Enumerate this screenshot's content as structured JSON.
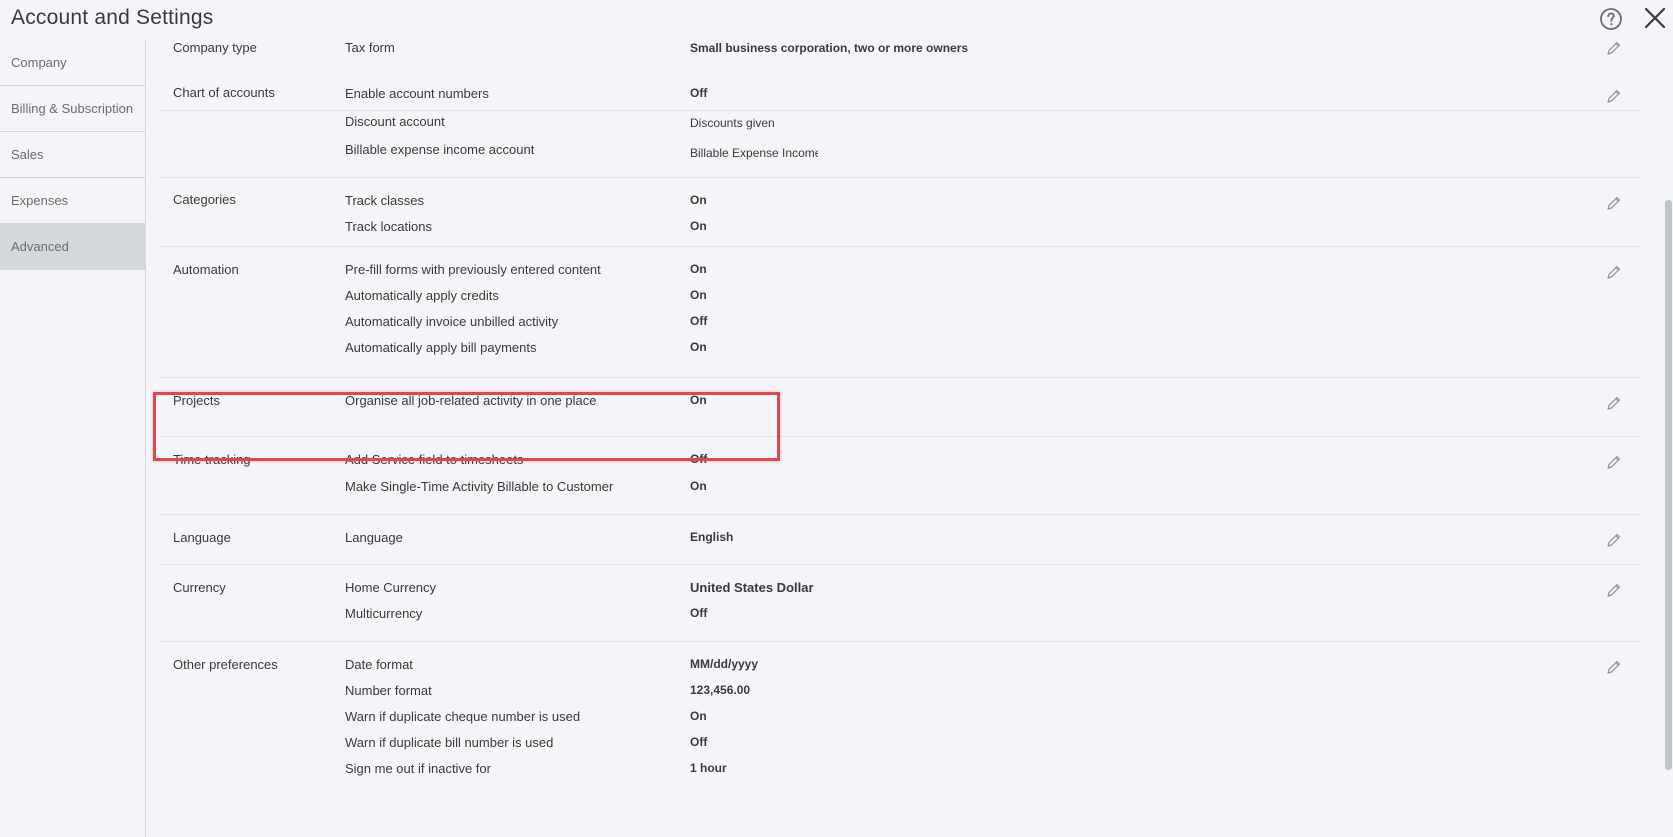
{
  "header": {
    "title": "Account and Settings"
  },
  "icons": {
    "help": "help-circle-icon",
    "close": "close-icon",
    "edit": "pencil-icon"
  },
  "colors": {
    "highlight_border": "#e0474c",
    "background": "#f4f5f8",
    "active_nav": "#d4d7dc"
  },
  "sidebar": {
    "items": [
      {
        "label": "Company"
      },
      {
        "label": "Billing & Subscription"
      },
      {
        "label": "Sales"
      },
      {
        "label": "Expenses"
      },
      {
        "label": "Advanced",
        "active": true
      }
    ]
  },
  "sections": {
    "company_type": {
      "name": "Company type",
      "rows": [
        {
          "label": "Tax form",
          "value": "Small business corporation, two or more owners"
        }
      ]
    },
    "chart_of_accounts": {
      "name": "Chart of accounts",
      "rows": [
        {
          "label": "Enable account numbers",
          "value": "Off"
        },
        {
          "label": "Discount account",
          "value": "Discounts given"
        },
        {
          "label": "Billable expense income account",
          "value": "Billable Expense Income"
        }
      ]
    },
    "categories": {
      "name": "Categories",
      "rows": [
        {
          "label": "Track classes",
          "value": "On"
        },
        {
          "label": "Track locations",
          "value": "On"
        }
      ]
    },
    "automation": {
      "name": "Automation",
      "rows": [
        {
          "label": "Pre-fill forms with previously entered content",
          "value": "On"
        },
        {
          "label": "Automatically apply credits",
          "value": "On"
        },
        {
          "label": "Automatically invoice unbilled activity",
          "value": "Off"
        },
        {
          "label": "Automatically apply bill payments",
          "value": "On"
        }
      ]
    },
    "projects": {
      "name": "Projects",
      "rows": [
        {
          "label": "Organise all job-related activity in one place",
          "value": "On"
        }
      ]
    },
    "time_tracking": {
      "name": "Time tracking",
      "rows": [
        {
          "label": "Add Service field to timesheets",
          "value": "Off"
        },
        {
          "label": "Make Single-Time Activity Billable to Customer",
          "value": "On"
        }
      ]
    },
    "language": {
      "name": "Language",
      "rows": [
        {
          "label": "Language",
          "value": "English"
        }
      ]
    },
    "currency": {
      "name": "Currency",
      "rows": [
        {
          "label": "Home Currency",
          "value": "United States Dollar"
        },
        {
          "label": "Multicurrency",
          "value": "Off"
        }
      ]
    },
    "other_preferences": {
      "name": "Other preferences",
      "rows": [
        {
          "label": "Date format",
          "value": "MM/dd/yyyy"
        },
        {
          "label": "Number format",
          "value": "123,456.00"
        },
        {
          "label": "Warn if duplicate cheque number is used",
          "value": "On"
        },
        {
          "label": "Warn if duplicate bill number is used",
          "value": "Off"
        },
        {
          "label": "Sign me out if inactive for",
          "value": "1 hour"
        }
      ]
    }
  }
}
